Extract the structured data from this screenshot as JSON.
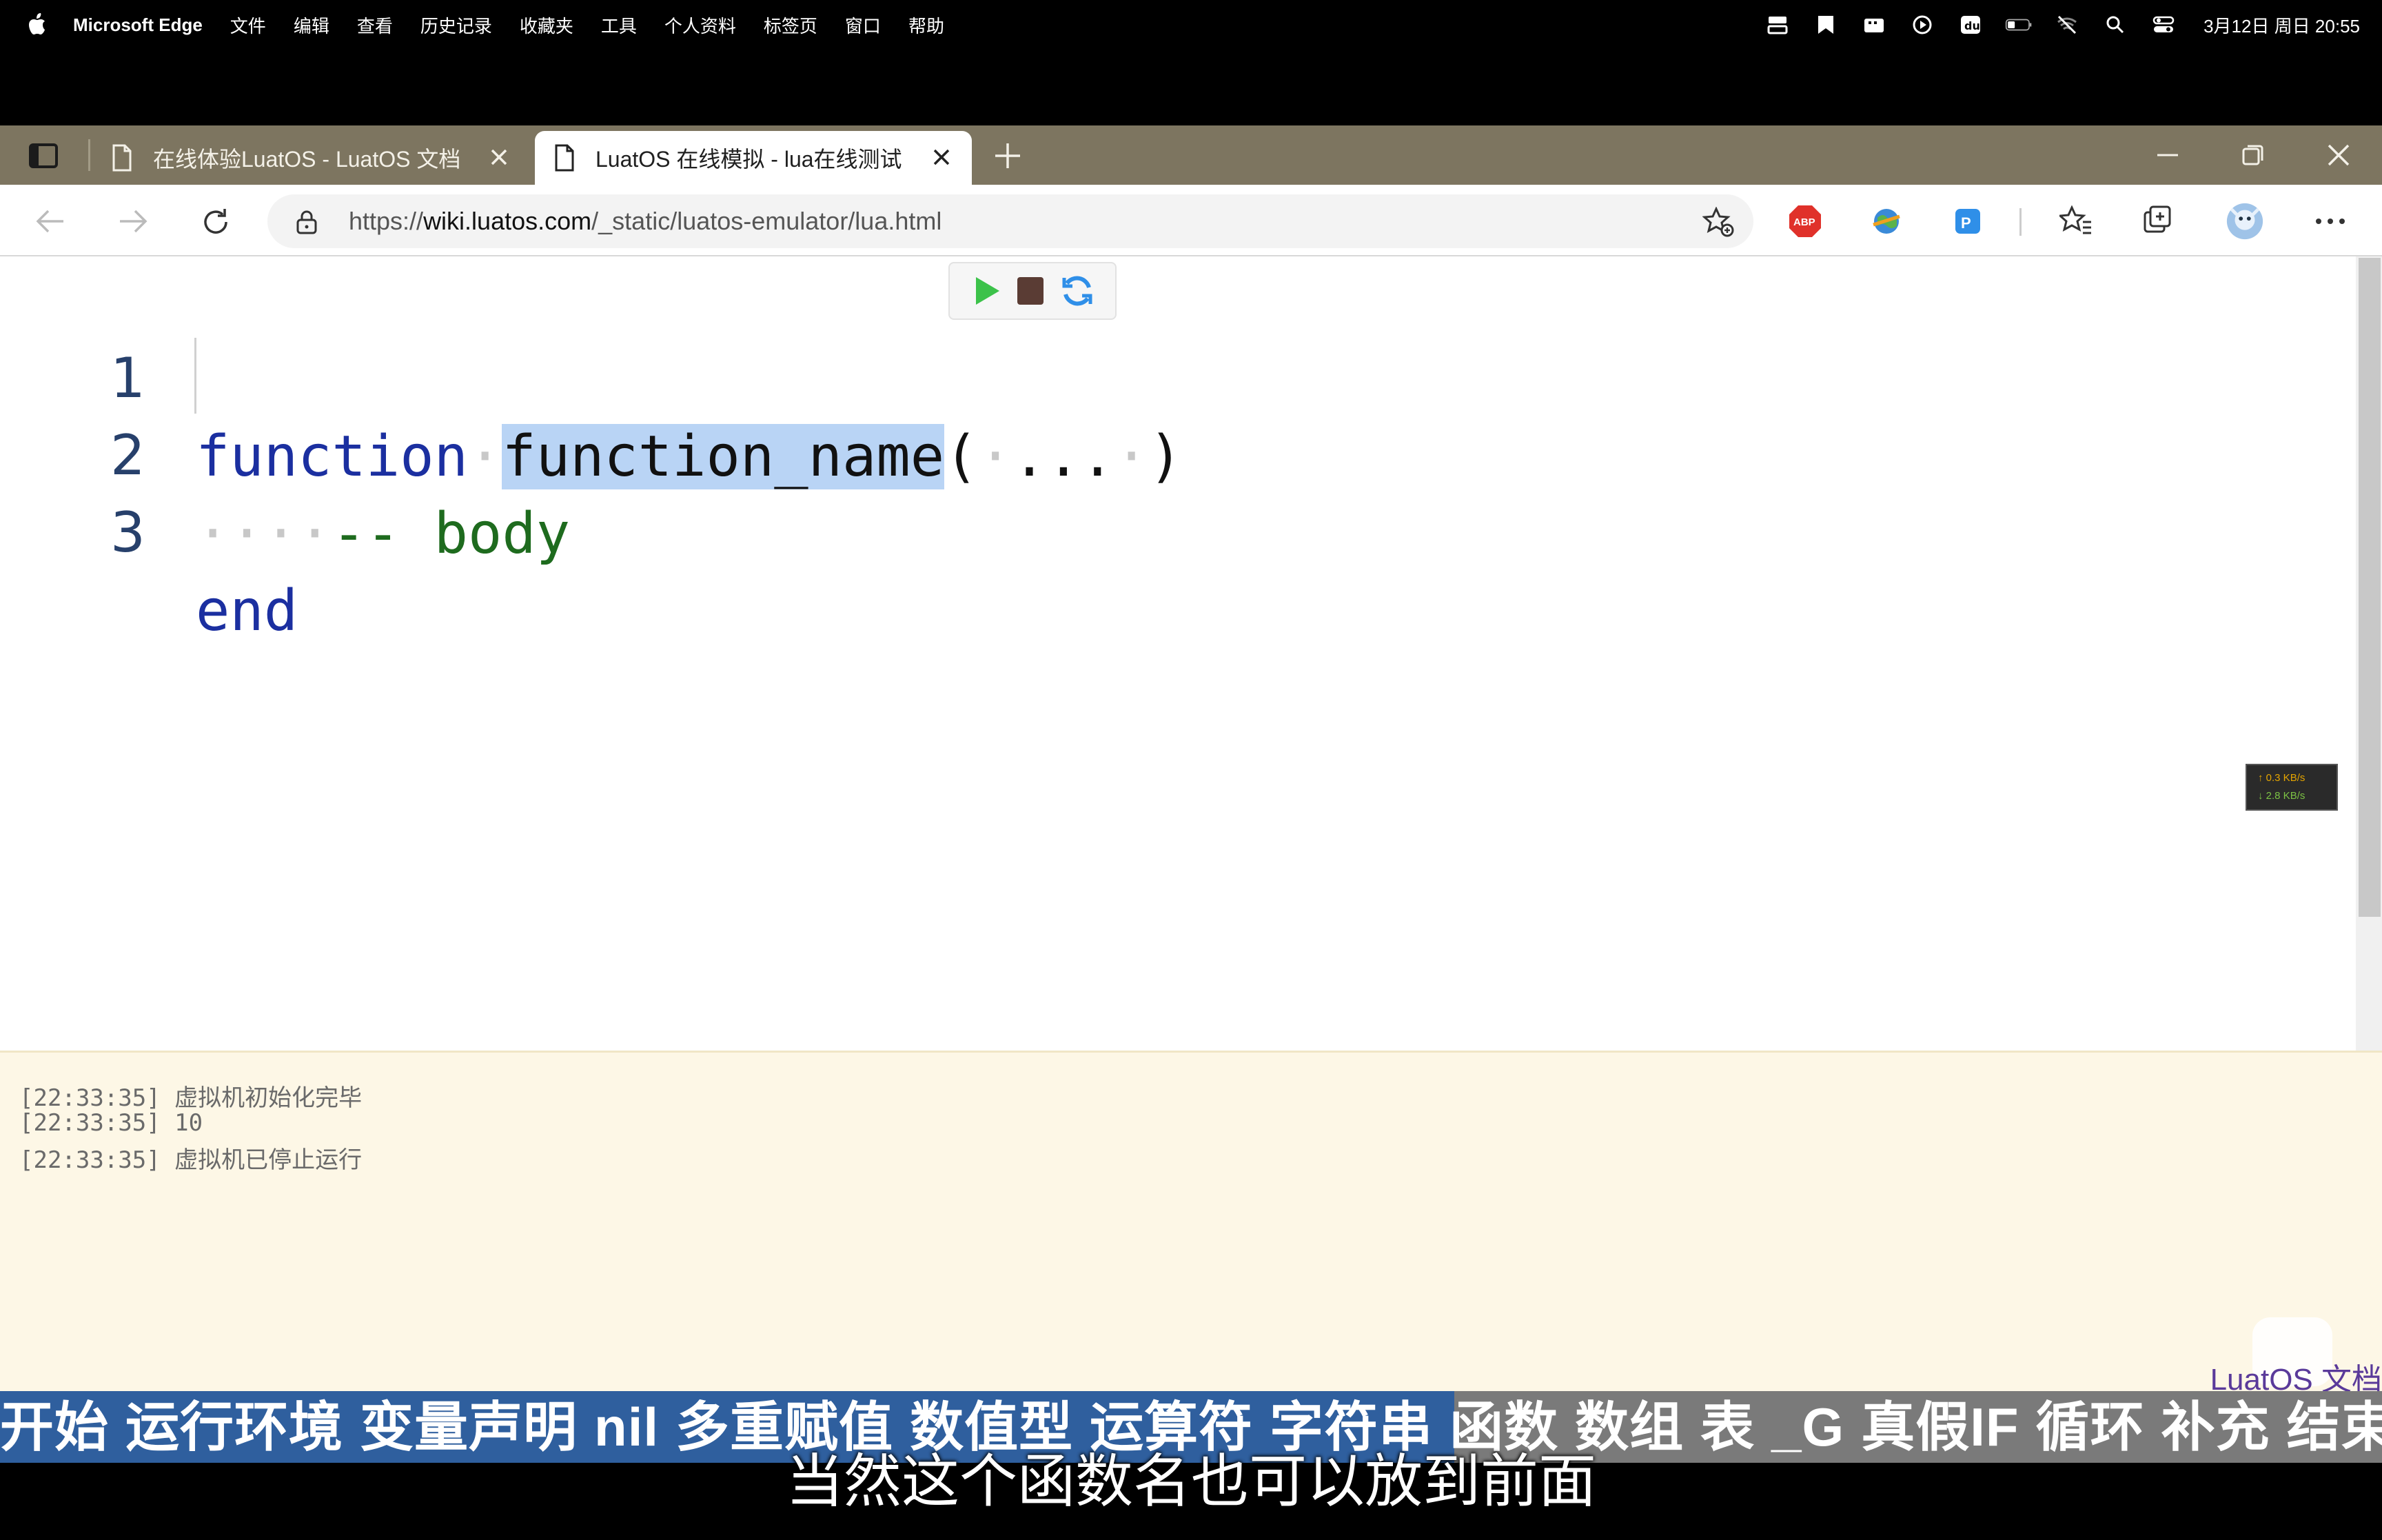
{
  "menubar": {
    "app_name": "Microsoft Edge",
    "items": [
      "文件",
      "编辑",
      "查看",
      "历史记录",
      "收藏夹",
      "工具",
      "个人资料",
      "标签页",
      "窗口",
      "帮助"
    ],
    "clock": "3月12日 周日 20:55"
  },
  "tabs": [
    {
      "title": "在线体验LuatOS - LuatOS 文档",
      "active": false
    },
    {
      "title": "LuatOS 在线模拟 - lua在线测试",
      "active": true
    }
  ],
  "address": {
    "scheme_prefix": "https://",
    "host": "wiki.luatos.com",
    "path": "/_static/luatos-emulator/lua.html"
  },
  "editor": {
    "lines": [
      {
        "number": "1",
        "keyword": "function",
        "name": "function_name",
        "paren_open": "(",
        "args": "...",
        "paren_close": ")"
      },
      {
        "number": "2",
        "comment": "-- body"
      },
      {
        "number": "3",
        "keyword": "end"
      }
    ]
  },
  "network": {
    "up": "↑ 0.3 KB/s",
    "down": "↓ 2.8 KB/s"
  },
  "console": {
    "logs": [
      "[22:33:35] 虚拟机初始化完毕",
      "[22:33:35] 10",
      "[22:33:35] 虚拟机已停止运行"
    ],
    "doc_link": "LuatOS 文档"
  },
  "chapters": [
    "开始",
    "运行环境",
    "变量声明",
    "nil",
    "多重赋值",
    "数值型",
    "运算符",
    "字符串",
    "函数",
    "数组",
    "表",
    "_G",
    "真假IF",
    "循环",
    "补充",
    "结束"
  ],
  "subtitle": "当然这个函数名也可以放到前面",
  "colors": {
    "tabstrip": "#7d7560",
    "console_bg": "#fdf7e6",
    "chapter_active": "#2f5f9e",
    "chapter_inactive": "#7a7a7a",
    "keyword": "#1b2fa0",
    "comment": "#1e6b1e"
  }
}
